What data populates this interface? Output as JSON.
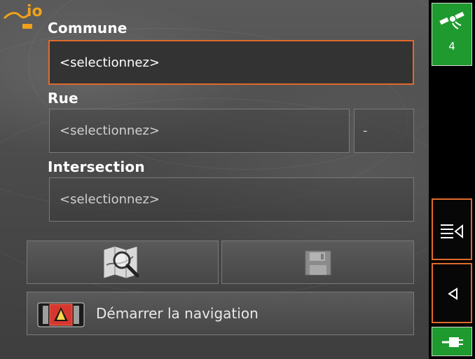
{
  "logo": {
    "text": "io"
  },
  "form": {
    "commune": {
      "label": "Commune",
      "value": "<selectionnez>"
    },
    "rue": {
      "label": "Rue",
      "value": "<selectionnez>",
      "number": "-"
    },
    "intersection": {
      "label": "Intersection",
      "value": "<selectionnez>"
    }
  },
  "actions": {
    "navigate_label": "Démarrer la navigation"
  },
  "sidebar": {
    "gps_satellites": "4"
  },
  "colors": {
    "accent_border": "#e06a2c",
    "status_green": "#1f9a2f"
  },
  "icons": {
    "map_search": "map-search-icon",
    "save": "floppy-disk-icon",
    "navigation": "navigation-screen-icon",
    "gps": "satellite-icon",
    "menu": "menu-list-icon",
    "back": "back-arrow-icon",
    "power": "power-plug-icon"
  }
}
